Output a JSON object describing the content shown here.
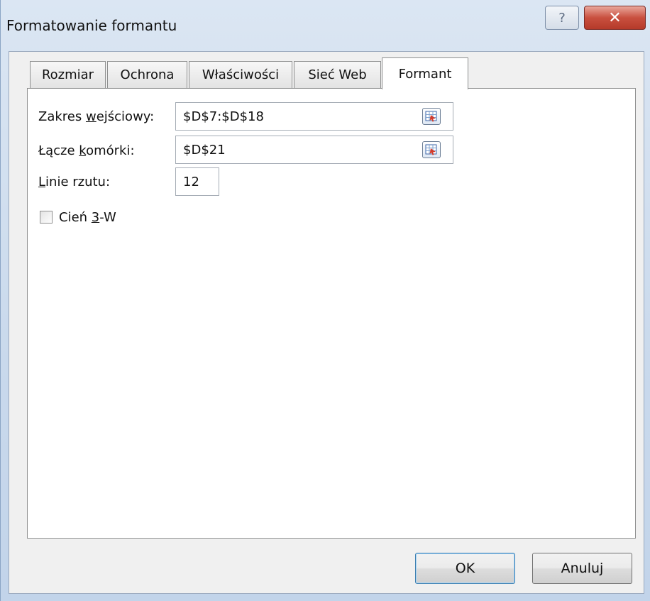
{
  "window": {
    "title": "Formatowanie formantu",
    "help_glyph": "?",
    "close_glyph": "✕"
  },
  "tabs": [
    {
      "label": "Rozmiar",
      "active": false
    },
    {
      "label": "Ochrona",
      "active": false
    },
    {
      "label": "Właściwości",
      "active": false
    },
    {
      "label": "Sieć Web",
      "active": false
    },
    {
      "label": "Formant",
      "active": true
    }
  ],
  "form": {
    "input_range": {
      "label_pre": "Zakres ",
      "label_u": "w",
      "label_post": "ejściowy:",
      "value": "$D$7:$D$18"
    },
    "cell_link": {
      "label_pre": "Łącze ",
      "label_u": "k",
      "label_post": "omórki:",
      "value": "$D$21"
    },
    "drop_lines": {
      "label_u": "L",
      "label_post": "inie rzutu:",
      "value": "12"
    },
    "shadow_3d": {
      "label_pre": "Cień ",
      "label_u": "3",
      "label_post": "-W",
      "checked": false
    }
  },
  "buttons": {
    "ok": "OK",
    "cancel": "Anuluj"
  },
  "icons": {
    "help": "help-icon",
    "close": "close-icon",
    "range_picker": "range-picker-icon"
  }
}
